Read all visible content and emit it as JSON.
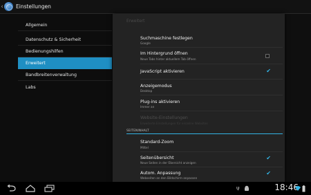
{
  "action_bar": {
    "title": "Einstellungen",
    "back_icon": "‹"
  },
  "sidebar": {
    "items": [
      {
        "label": "Allgemein",
        "selected": false
      },
      {
        "label": "Datenschutz & Sicherheit",
        "selected": false
      },
      {
        "label": "Bedienungshilfen",
        "selected": false
      },
      {
        "label": "Erweitert",
        "selected": true
      },
      {
        "label": "Bandbreitenverwaltung",
        "selected": false
      },
      {
        "label": "Labs",
        "selected": false
      }
    ]
  },
  "panel": {
    "header": "Erweitert",
    "prefs": [
      {
        "title": "Suchmaschine festlegen",
        "summary": "Google",
        "control": "none"
      },
      {
        "title": "Im Hintergrund öffnen",
        "summary": "Neue Tabs hinter aktuellem Tab öffnen",
        "control": "checkbox",
        "checked": false
      },
      {
        "title": "JavaScript aktivieren",
        "summary": "",
        "control": "checkbox",
        "checked": true
      },
      {
        "title": "Anzeigemodus",
        "summary": "Desktop",
        "control": "none"
      },
      {
        "title": "Plug-ins aktivieren",
        "summary": "Immer an",
        "control": "none"
      },
      {
        "title": "Website-Einstellungen",
        "summary": "Erweiterte Einstellungen für einzelne Websites",
        "control": "none",
        "disabled": true
      }
    ],
    "section_header": "SEITENINHALT",
    "prefs2": [
      {
        "title": "Standard-Zoom",
        "summary": "Mittel",
        "control": "none"
      },
      {
        "title": "Seitenübersicht",
        "summary": "Neue Seiten in der Übersicht anzeigen",
        "control": "checkbox",
        "checked": true
      },
      {
        "title": "Autom. Anpassung",
        "summary": "Webseiten an den Bildschirm anpassen",
        "control": "checkbox",
        "checked": true
      }
    ]
  },
  "system_bar": {
    "clock": "18:46",
    "icons": [
      "back-icon",
      "home-icon",
      "recents-icon",
      "usb-icon",
      "android-icon",
      "wifi-icon",
      "battery-icon"
    ]
  },
  "colors": {
    "accent": "#33b5e5",
    "selected": "#1f8fc3"
  }
}
